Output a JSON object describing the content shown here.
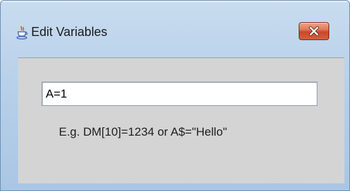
{
  "window": {
    "title": "Edit Variables",
    "app_icon": "java-cup-icon",
    "close_icon": "close-icon"
  },
  "editor": {
    "input_value": "A=1",
    "hint": "E.g. DM[10]=1234 or A$=\"Hello\""
  },
  "colors": {
    "frame": "#b9d1ea",
    "client_background": "#d4d4d4",
    "close_button": "#c9472a"
  }
}
